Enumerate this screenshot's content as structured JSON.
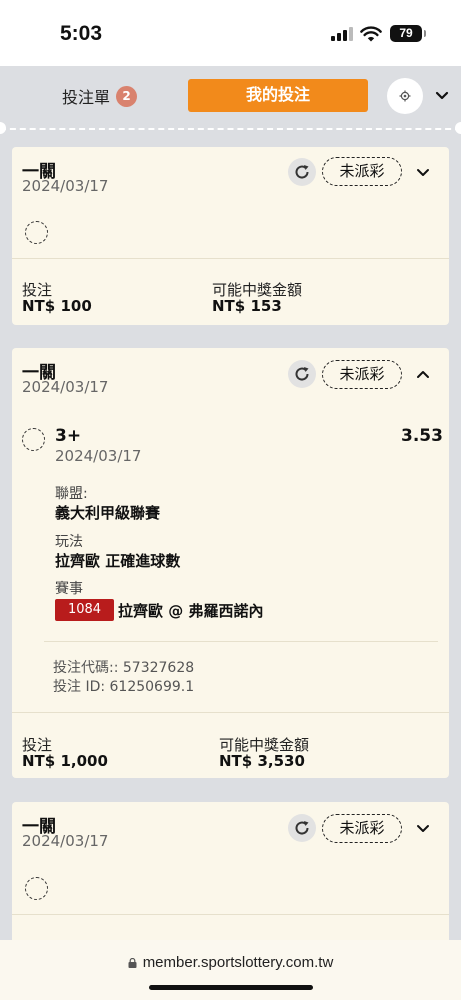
{
  "status_bar": {
    "time": "5:03",
    "battery": "79"
  },
  "header": {
    "tab_bets_label": "投注單",
    "tab_bets_count": "2",
    "tab_mybets_label": "我的投注",
    "accent_color": "#f28a1b"
  },
  "cards": [
    {
      "type": "一關",
      "date": "2024/03/17",
      "status": "未派彩",
      "stake_label": "投注",
      "stake_value": "NT$ 100",
      "payout_label": "可能中獎金額",
      "payout_value": "NT$ 153"
    },
    {
      "type": "一關",
      "date": "2024/03/17",
      "status": "未派彩",
      "selection": {
        "name": "3+",
        "odds": "3.53",
        "date": "2024/03/17",
        "league_label": "聯盟:",
        "league_value": "義大利甲級聯賽",
        "market_label": "玩法",
        "market_value": "拉齊歐 正確進球數",
        "event_label": "賽事",
        "match_code": "1084",
        "match_name": "拉齊歐 @ 弗羅西諾內"
      },
      "bet_code": "投注代碼:: 57327628",
      "bet_id": "投注 ID: 61250699.1",
      "stake_label": "投注",
      "stake_value": "NT$ 1,000",
      "payout_label": "可能中獎金額",
      "payout_value": "NT$ 3,530"
    },
    {
      "type": "一關",
      "date": "2024/03/17",
      "status": "未派彩"
    }
  ],
  "browser": {
    "url": "member.sportslottery.com.tw"
  }
}
